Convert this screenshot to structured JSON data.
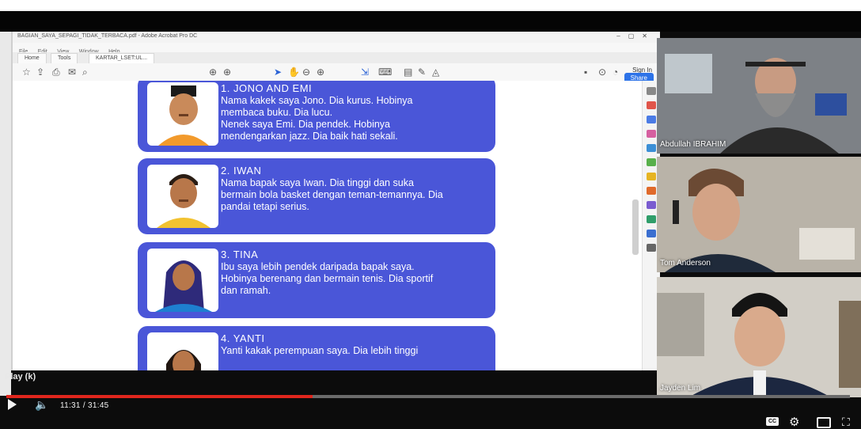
{
  "pdf_viewer": {
    "title": "BAGIAN_SAYA_SEPAGI_TIDAK_TERBACA.pdf - Adobe Acrobat Pro DC",
    "menu": [
      "File",
      "Edit",
      "View",
      "Window",
      "Help"
    ],
    "tabs": [
      "Home",
      "Tools",
      "KARTAR_LSET:UL..."
    ],
    "sign_in": "Sign In",
    "share": "Share"
  },
  "cards": [
    {
      "title": "1. JONO AND EMI",
      "lines": [
        "Nama kakek saya Jono. Dia kurus. Hobinya",
        "membaca buku. Dia lucu.",
        "Nenek saya Emi. Dia pendek. Hobinya",
        "mendengarkan jazz. Dia baik hati sekali."
      ]
    },
    {
      "title": "2. IWAN",
      "lines": [
        "Nama bapak saya Iwan. Dia tinggi dan suka",
        "bermain bola basket dengan teman-temannya. Dia",
        "pandai tetapi serius."
      ]
    },
    {
      "title": "3. TINA",
      "lines": [
        "Ibu saya lebih pendek daripada bapak saya.",
        "Hobinya berenang dan bermain tenis. Dia sportif",
        "dan ramah."
      ]
    },
    {
      "title": "4. YANTI",
      "lines": [
        "Yanti kakak perempuan saya. Dia lebih tinggi"
      ]
    }
  ],
  "player": {
    "tooltip": "Play (k)",
    "time": "11:31 / 31:45",
    "progress": 0.363,
    "cc": "CC",
    "colors": {
      "progress": "#e0261d",
      "card": "#4a56d8"
    }
  },
  "participants": [
    {
      "name": "Abdullah IBRAHIM"
    },
    {
      "name": "Tom Anderson"
    },
    {
      "name": "Jayden Lim"
    }
  ]
}
